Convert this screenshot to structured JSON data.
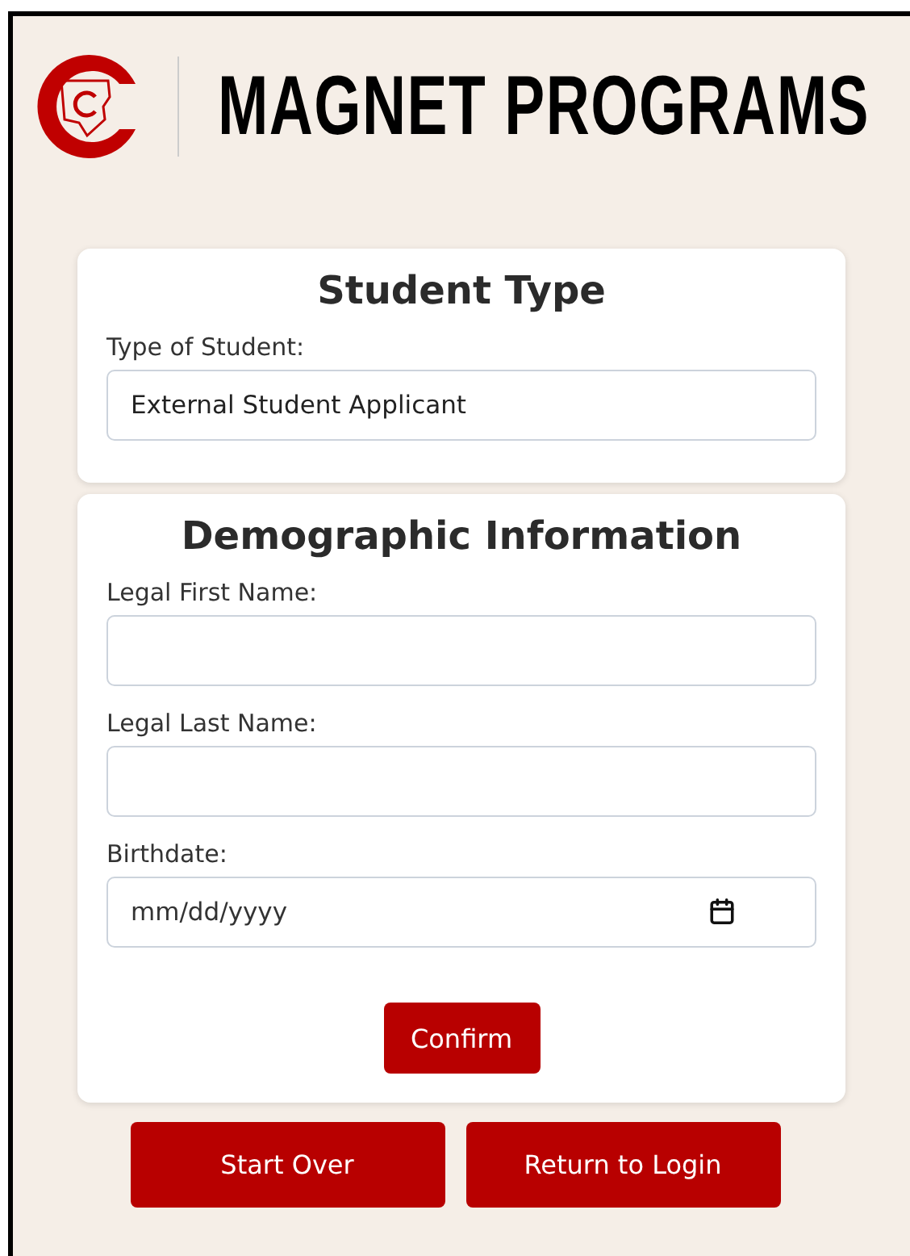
{
  "header": {
    "title": "MAGNET PROGRAMS"
  },
  "sections": [
    {
      "title": "Student Type",
      "fields": [
        {
          "kind": "text",
          "label": "Type of Student:",
          "value": "External Student Applicant"
        }
      ]
    },
    {
      "title": "Demographic Information",
      "fields": [
        {
          "kind": "text",
          "label": "Legal First Name:"
        },
        {
          "kind": "text",
          "label": "Legal Last Name:"
        },
        {
          "kind": "date",
          "label": "Birthdate:",
          "placeholder": "mm/dd/yyyy"
        }
      ],
      "button": "Confirm"
    }
  ],
  "actions": [
    "Start Over",
    "Return to Login"
  ]
}
